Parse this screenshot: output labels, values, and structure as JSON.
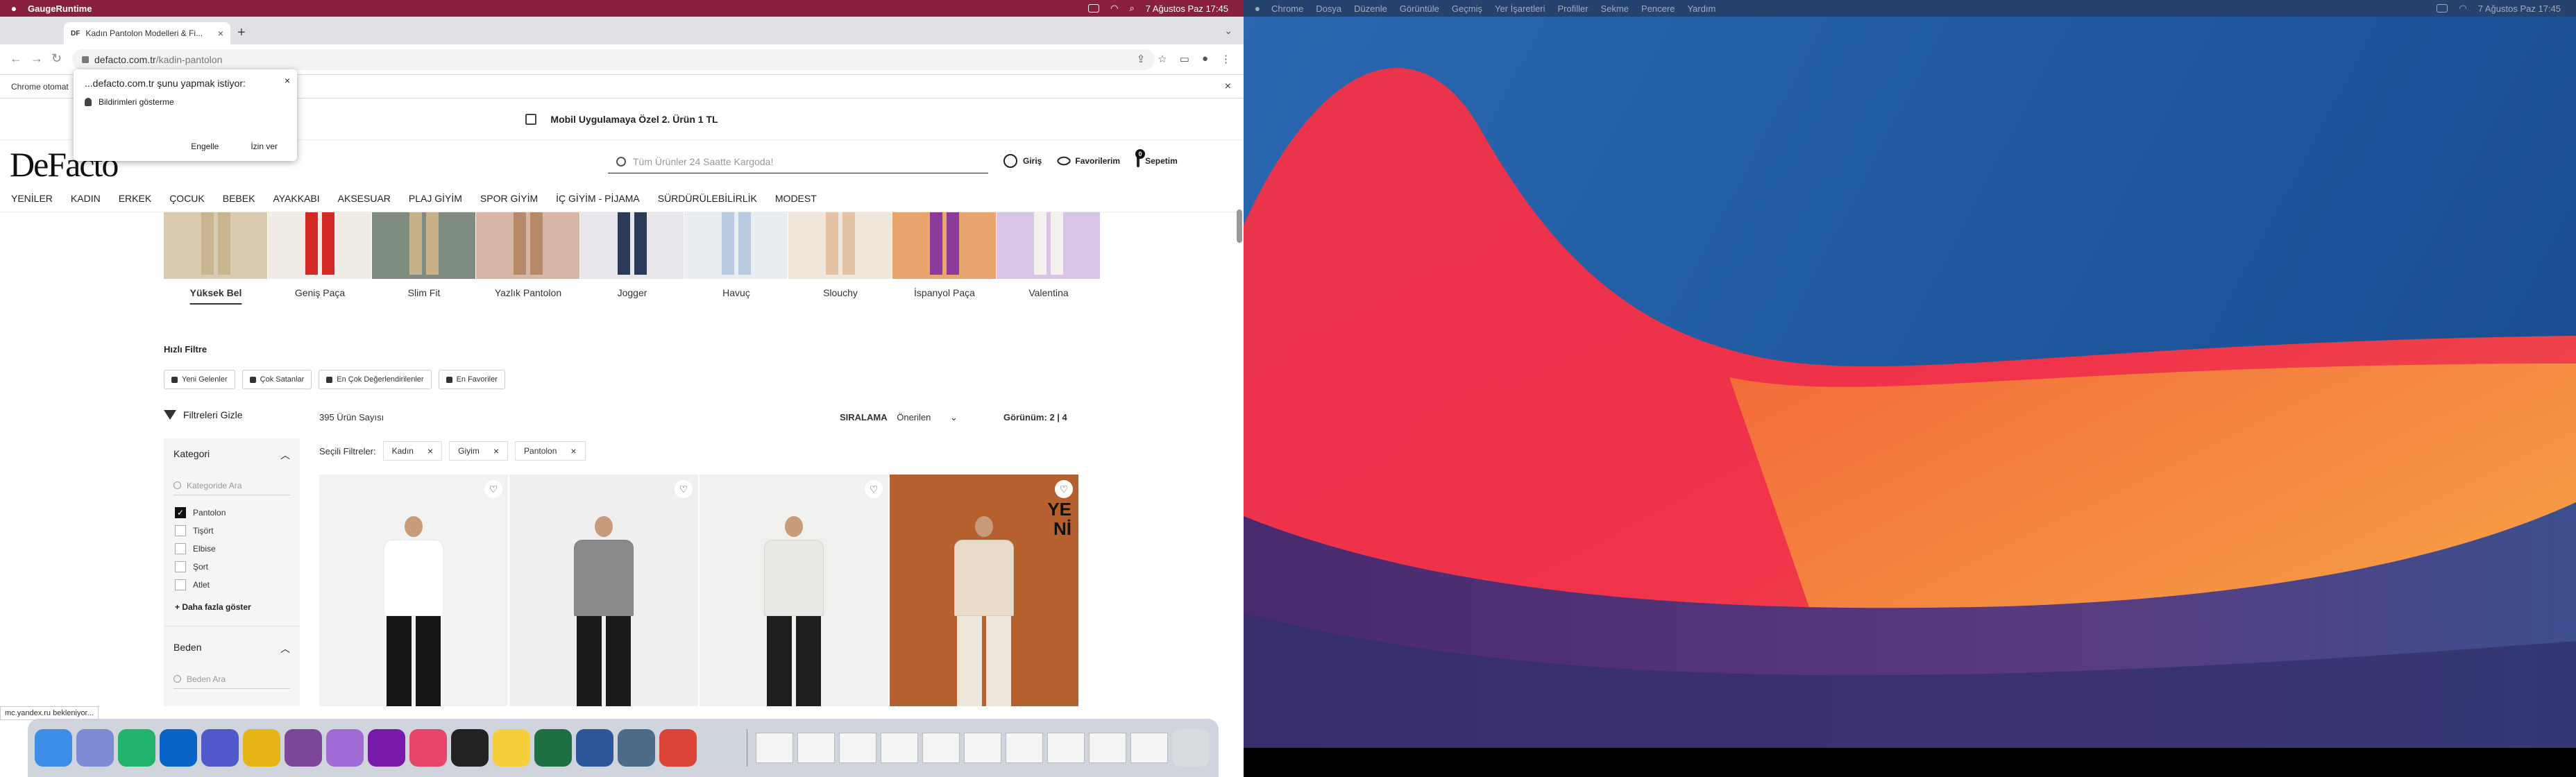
{
  "menubar_left": {
    "app": "GaugeRuntime",
    "clock": "7 Ağustos Paz  17:45"
  },
  "menubar_right": {
    "items": [
      "Chrome",
      "Dosya",
      "Düzenle",
      "Görüntüle",
      "Geçmiş",
      "Yer İşaretleri",
      "Profiller",
      "Sekme",
      "Pencere",
      "Yardım"
    ],
    "clock": "7 Ağustos Paz  17:45"
  },
  "browser": {
    "tab_title": "Kadın Pantolon Modelleri & Fi...",
    "tab_favicon": "DF",
    "url_domain": "defacto.com.tr",
    "url_path": "/kadin-pantolon",
    "infobar_text": "Chrome otomat",
    "status_text": "mc.yandex.ru bekleniyor..."
  },
  "permission_popup": {
    "title": "...defacto.com.tr şunu yapmak istiyor:",
    "permission": "Bildirimleri gösterme",
    "block": "Engelle",
    "allow": "İzin ver"
  },
  "site": {
    "promo": "Mobil Uygulamaya Özel 2. Ürün 1 TL",
    "logo": "DeFacto",
    "search_placeholder": "Tüm Ürünler 24 Saatte Kargoda!",
    "login": "Giriş",
    "favorites": "Favorilerim",
    "cart": "Sepetim",
    "cart_count": "0",
    "nav": [
      "YENİLER",
      "KADIN",
      "ERKEK",
      "ÇOCUK",
      "BEBEK",
      "AYAKKABI",
      "AKSESUAR",
      "PLAJ GİYİM",
      "SPOR GİYİM",
      "İÇ GİYİM - PİJAMA",
      "SÜRDÜRÜLEBİLİRLİK",
      "MODEST"
    ]
  },
  "styles": [
    {
      "label": "Yüksek Bel",
      "color": "#d9cbb0",
      "leg": "#c9b690"
    },
    {
      "label": "Geniş Paça",
      "color": "#f1ece6",
      "leg": "#d42a26"
    },
    {
      "label": "Slim Fit",
      "color": "#7f8c80",
      "leg": "#c8b28a"
    },
    {
      "label": "Yazlık Pantolon",
      "color": "#d6b7a5",
      "leg": "#b78a6a"
    },
    {
      "label": "Jogger",
      "color": "#e8e8ec",
      "leg": "#2c3a5a"
    },
    {
      "label": "Havuç",
      "color": "#e9edf2",
      "leg": "#b9cbe0"
    },
    {
      "label": "Slouchy",
      "color": "#f1e6da",
      "leg": "#e3c3a4"
    },
    {
      "label": "İspanyol Paça",
      "color": "#e8a46c",
      "leg": "#8a3a9a"
    },
    {
      "label": "Valentina",
      "color": "#d8c4e4",
      "leg": "#f4f0ee"
    }
  ],
  "quick_filter": {
    "title": "Hızlı Filtre",
    "chips": [
      "Yeni Gelenler",
      "Çok Satanlar",
      "En Çok Değerlendirilenler",
      "En Favoriler"
    ]
  },
  "listing": {
    "hide_filters": "Filtreleri Gizle",
    "count": "395 Ürün Sayısı",
    "sort_label": "SIRALAMA",
    "sort_value": "Önerilen",
    "view_label": "Görünüm:",
    "view_value": "2 | 4",
    "selected_label": "Seçili Filtreler:",
    "selected": [
      "Kadın",
      "Giyim",
      "Pantolon"
    ]
  },
  "sidebar": {
    "category_title": "Kategori",
    "category_search": "Kategoride Ara",
    "categories": [
      {
        "label": "Pantolon",
        "checked": true
      },
      {
        "label": "Tişört",
        "checked": false
      },
      {
        "label": "Elbise",
        "checked": false
      },
      {
        "label": "Şort",
        "checked": false
      },
      {
        "label": "Atlet",
        "checked": false
      }
    ],
    "more": "+ Daha fazla göster",
    "size_title": "Beden",
    "size_search": "Beden Ara"
  },
  "products": [
    {
      "bg": "#f2f2f2",
      "top": "#ffffff",
      "bottom": "#151515",
      "yeni": false
    },
    {
      "bg": "#efefef",
      "top": "#8a8a8a",
      "bottom": "#1a1a1a",
      "yeni": false
    },
    {
      "bg": "#f0f0ee",
      "top": "#e9e9e6",
      "bottom": "#1e1e1e",
      "yeni": false
    },
    {
      "bg": "#b5602e",
      "top": "#e8dcc8",
      "bottom": "#efe7dc",
      "yeni": true
    }
  ],
  "yeni_text": [
    "YE",
    "Nİ"
  ],
  "dock": [
    {
      "name": "finder",
      "color": "#3a8ee6"
    },
    {
      "name": "launchpad",
      "color": "#7b8bd4"
    },
    {
      "name": "pycharm",
      "color": "#1fb36b"
    },
    {
      "name": "outlook",
      "color": "#0a64c8"
    },
    {
      "name": "teams",
      "color": "#5059c9"
    },
    {
      "name": "chrome",
      "color": "#e7b416"
    },
    {
      "name": "tor",
      "color": "#7d4698"
    },
    {
      "name": "color",
      "color": "#a06bd4"
    },
    {
      "name": "onenote",
      "color": "#7719aa"
    },
    {
      "name": "intellij",
      "color": "#e8456b"
    },
    {
      "name": "terminal",
      "color": "#222222"
    },
    {
      "name": "notes",
      "color": "#f5cf3a"
    },
    {
      "name": "excel",
      "color": "#1d7044"
    },
    {
      "name": "word",
      "color": "#2b579a"
    },
    {
      "name": "preview",
      "color": "#4a6b8a"
    },
    {
      "name": "chrome2",
      "color": "#db4437"
    },
    {
      "name": "files",
      "color": "#cfd6de"
    }
  ]
}
